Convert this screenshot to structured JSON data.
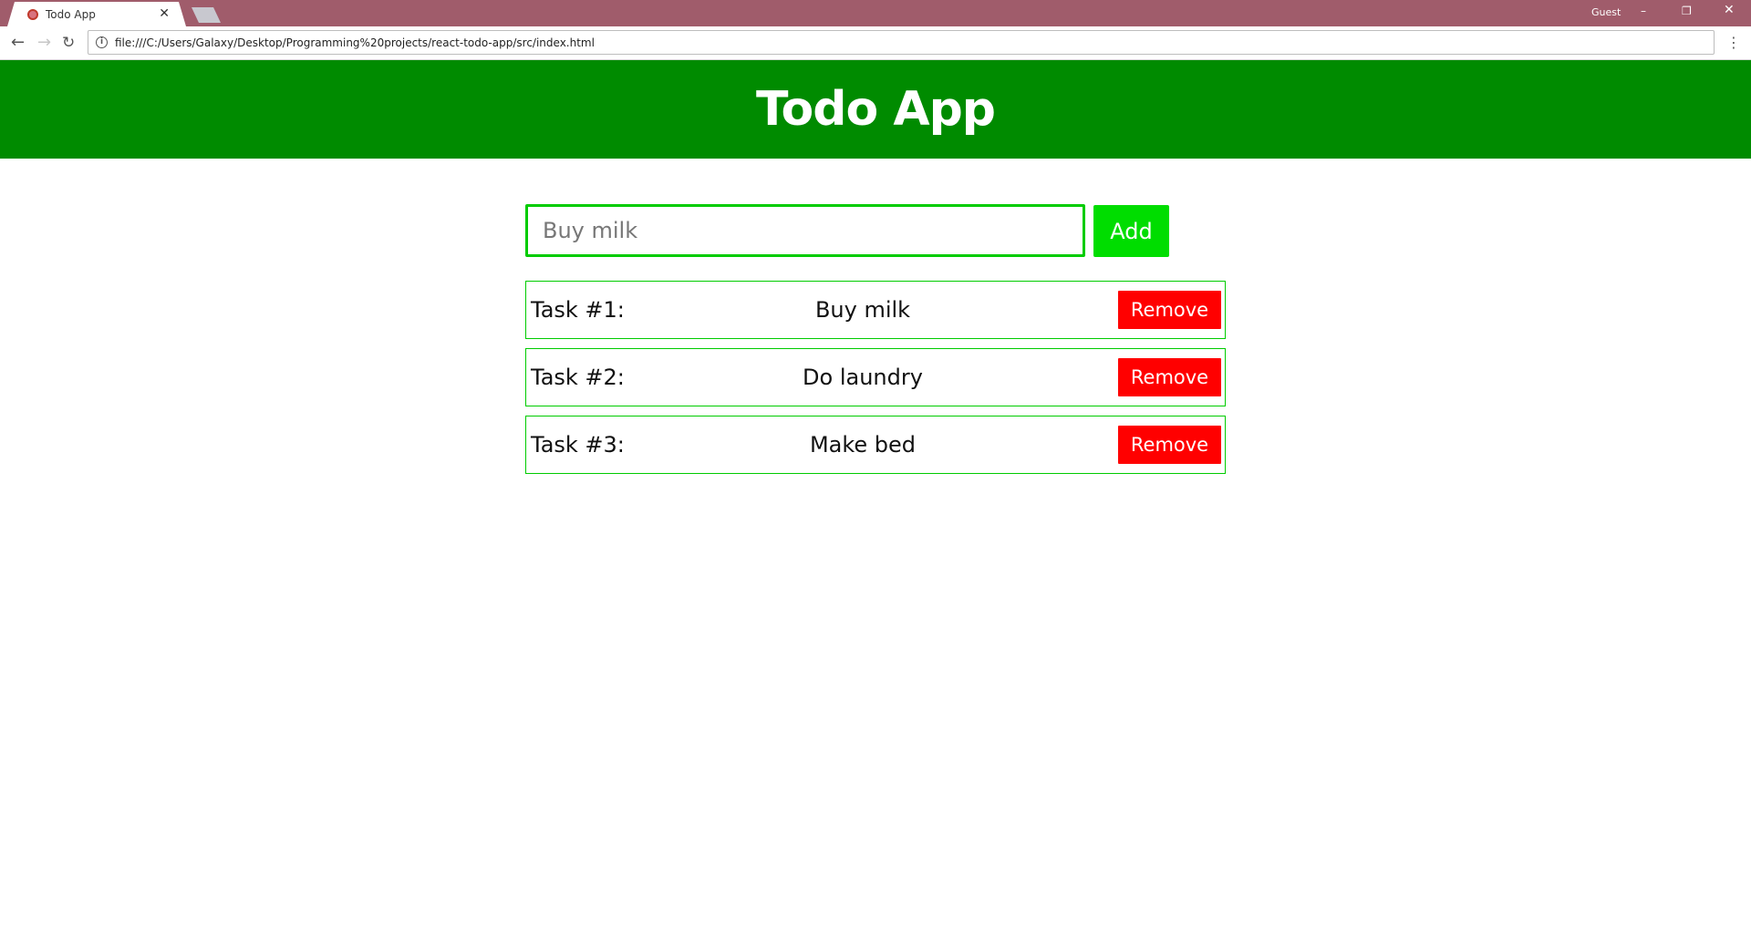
{
  "browser": {
    "tab_title": "Todo App",
    "tab_close": "✕",
    "profile_label": "Guest",
    "window_controls": {
      "minimize": "–",
      "maximize": "❐",
      "close": "✕"
    },
    "nav": {
      "back": "←",
      "forward": "→",
      "reload": "↻"
    },
    "url": "file:///C:/Users/Galaxy/Desktop/Programming%20projects/react-todo-app/src/index.html",
    "info_icon": "i",
    "menu_icon": "⋮"
  },
  "app": {
    "title": "Todo App",
    "colors": {
      "header": "#008b00",
      "input_border": "#00cc00",
      "add_button": "#00dd00",
      "remove_button": "#ff0000",
      "tab_strip": "#a05c6b"
    },
    "input": {
      "placeholder": "Buy milk",
      "value": ""
    },
    "add_label": "Add",
    "tasks": [
      {
        "number_label": "Task #1:",
        "text": "Buy milk",
        "remove_label": "Remove"
      },
      {
        "number_label": "Task #2:",
        "text": "Do laundry",
        "remove_label": "Remove"
      },
      {
        "number_label": "Task #3:",
        "text": "Make bed",
        "remove_label": "Remove"
      }
    ]
  }
}
